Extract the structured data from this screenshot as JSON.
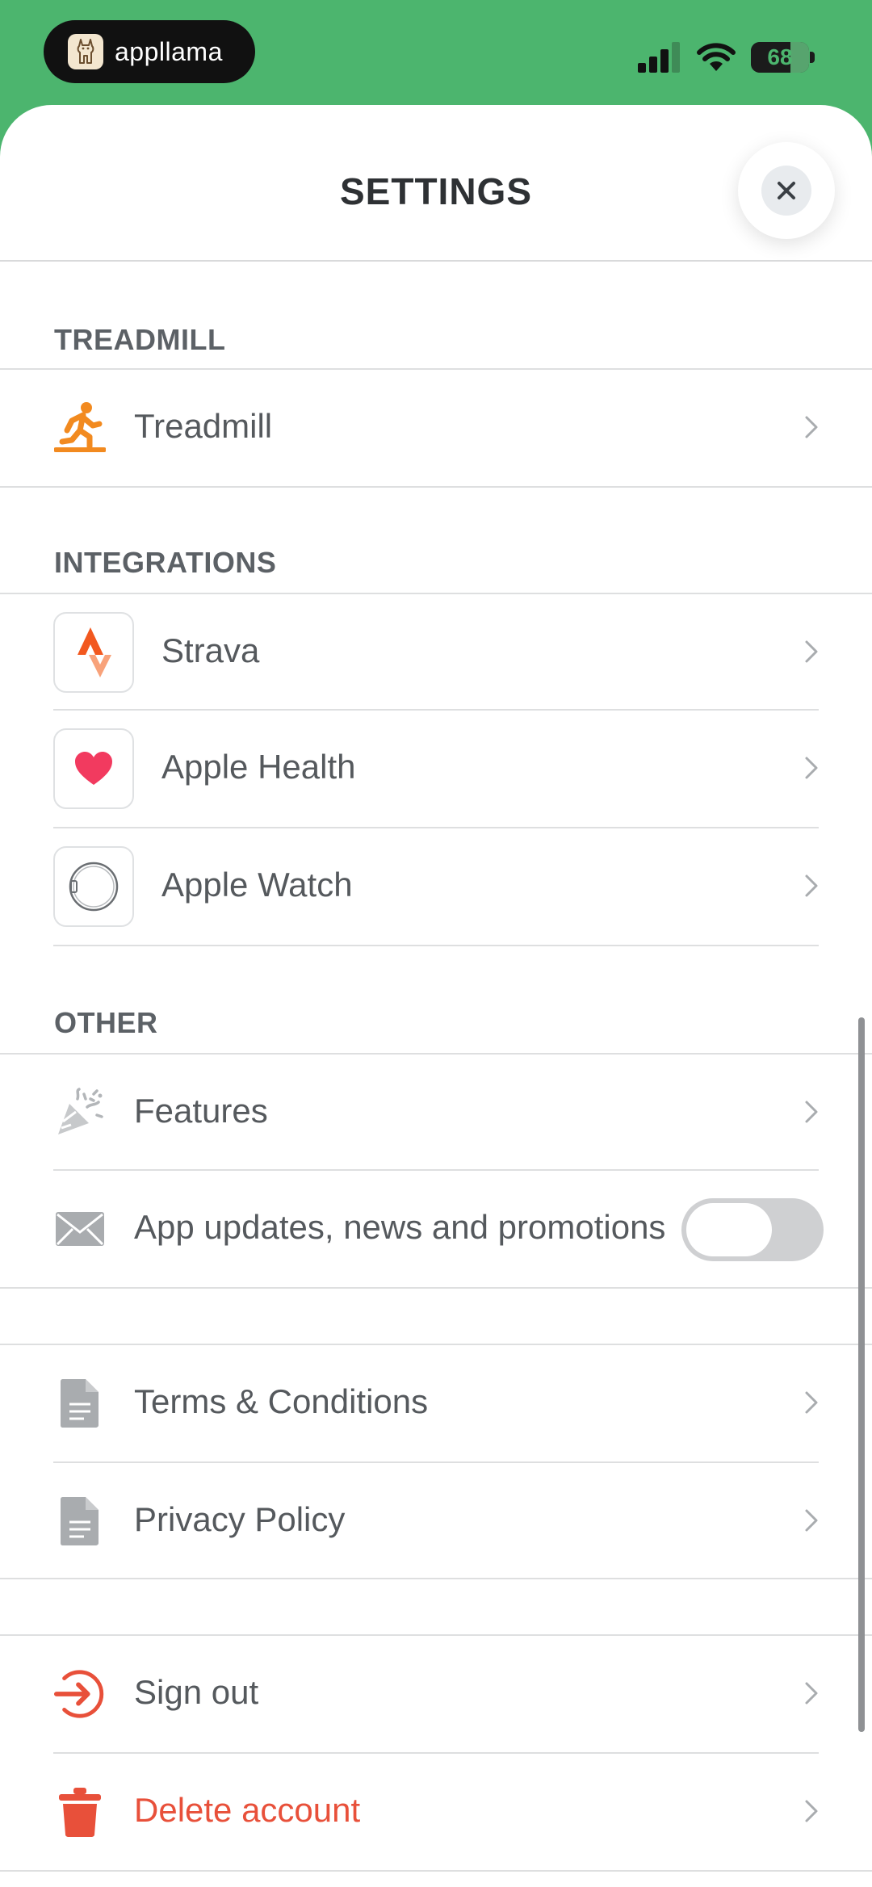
{
  "status_bar": {
    "brand": "appllama",
    "battery": "68",
    "battery_level": 0.68
  },
  "sheet": {
    "title": "SETTINGS"
  },
  "sections": {
    "treadmill": {
      "header": "TREADMILL",
      "items": [
        {
          "label": "Treadmill",
          "icon": "treadmill-runner-icon"
        }
      ]
    },
    "integrations": {
      "header": "INTEGRATIONS",
      "items": [
        {
          "label": "Strava",
          "icon": "strava-icon"
        },
        {
          "label": "Apple Health",
          "icon": "heart-icon"
        },
        {
          "label": "Apple Watch",
          "icon": "watch-icon"
        }
      ]
    },
    "other": {
      "header": "OTHER",
      "items": [
        {
          "label": "Features",
          "icon": "confetti-icon"
        },
        {
          "label": "App updates, news and promotions",
          "icon": "envelope-icon",
          "toggle_on": false
        }
      ]
    },
    "legal": {
      "items": [
        {
          "label": "Terms & Conditions",
          "icon": "document-icon"
        },
        {
          "label": "Privacy Policy",
          "icon": "document-icon"
        }
      ]
    },
    "account": {
      "items": [
        {
          "label": "Sign out",
          "icon": "sign-out-icon"
        },
        {
          "label": "Delete account",
          "icon": "trash-icon"
        }
      ]
    }
  },
  "colors": {
    "status_green": "#4cb56e",
    "accent_orange": "#f28a1f",
    "danger_red": "#e8503a",
    "heart_pink": "#f23a5f"
  }
}
